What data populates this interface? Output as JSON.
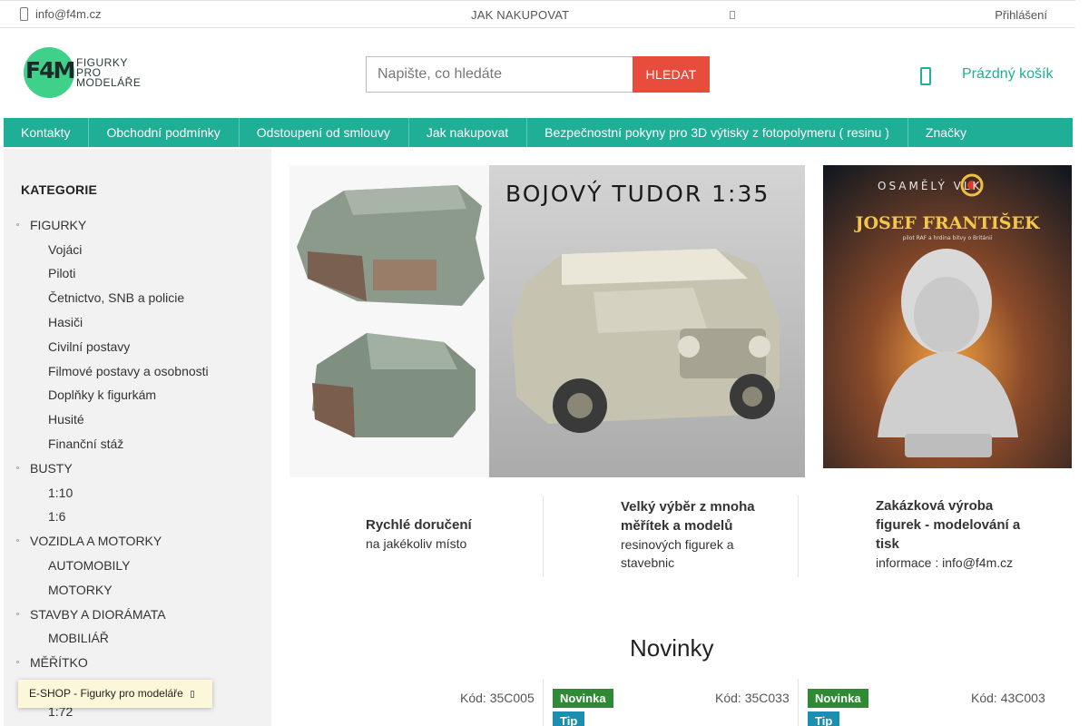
{
  "topbar": {
    "email": "info@f4m.cz",
    "how_to_buy": "JAK NAKUPOVAT",
    "login": "Přihlášení"
  },
  "logo": {
    "mark": "F4M",
    "line1": "FIGURKY",
    "line2": "PRO",
    "line3": "MODELÁŘE"
  },
  "search": {
    "placeholder": "Napište, co hledáte",
    "button": "HLEDAT"
  },
  "cart": {
    "label": "Prázdný košík"
  },
  "nav": {
    "items": [
      "Kontakty",
      "Obchodní podmínky",
      "Odstoupení od smlouvy",
      "Jak nakupovat",
      "Bezpečnostní pokyny pro 3D výtisky z fotopolymeru ( resinu )",
      "Značky"
    ]
  },
  "sidebar": {
    "title": "KATEGORIE",
    "cat_figurky": "FIGURKY",
    "figurky_subs": [
      "Vojáci",
      "Piloti",
      "Četnictvo, SNB a policie",
      "Hasiči",
      "Civilní postavy",
      "Filmové postavy a osobnosti",
      "Doplňky k figurkám",
      "Husité",
      "Finanční stáž"
    ],
    "cat_busty": "BUSTY",
    "busty_subs": [
      "1:10",
      "1:6"
    ],
    "cat_vozidla": "VOZIDLA A MOTORKY",
    "vozidla_subs": [
      "AUTOMOBILY",
      "MOTORKY"
    ],
    "cat_stavby": "STAVBY A DIORÁMATA",
    "stavby_subs": [
      "MOBILIÁŘ"
    ],
    "cat_meritko": "MĚŘÍTKO",
    "meritko_subs": [
      "1:72"
    ]
  },
  "toast": {
    "text": "E-SHOP - Figurky pro modeláře"
  },
  "banners": {
    "left_title": "BOJOVÝ TUDOR 1:35",
    "right_top": "OSAMĚLÝ VLK",
    "right_title": "JOSEF FRANTIŠEK",
    "right_sub": "pilot RAF a hrdina bitvy o Británii"
  },
  "benefits": [
    {
      "title": "Rychlé doručení",
      "desc": "na jakékoliv místo"
    },
    {
      "title": "Velký výběr z mnoha měřítek a modelů",
      "desc": "resinových figurek a stavebnic"
    },
    {
      "title": "Zakázková výroba figurek - modelování a tisk",
      "desc": "informace : info@f4m.cz"
    }
  ],
  "section_title": "Novinky",
  "products": [
    {
      "code": "Kód: 35C005"
    },
    {
      "code": "Kód: 35C033",
      "badge1": "Novinka",
      "badge2": "Tip"
    },
    {
      "code": "Kód: 43C003",
      "badge1": "Novinka",
      "badge2": "Tip"
    }
  ],
  "colors": {
    "primary": "#1fae96",
    "search_button": "#e84c3d",
    "badge_new": "#2e8b33",
    "badge_tip": "#1b8fb0"
  }
}
